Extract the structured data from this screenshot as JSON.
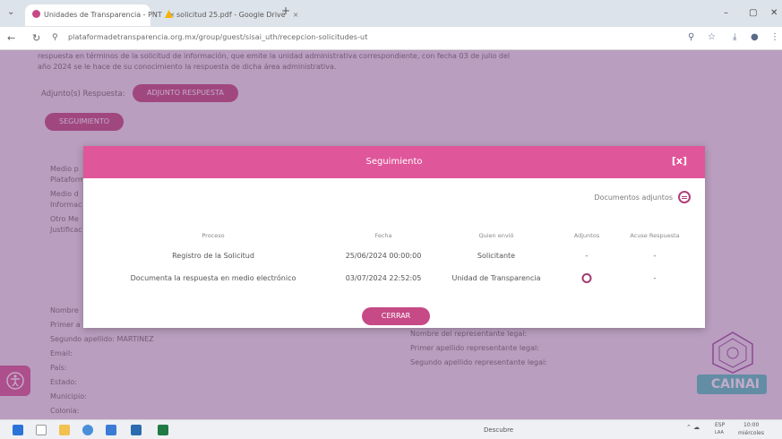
{
  "browser": {
    "tabs": [
      {
        "title": "Unidades de Transparencia - PNT",
        "active": true
      },
      {
        "title": "solicitud 25.pdf - Google Drive",
        "active": false
      }
    ],
    "new_tab": "+",
    "close_glyph": "×",
    "url": "plataformadetransparencia.org.mx/group/guest/sisai_uth/recepcion-solicitudes-ut"
  },
  "page": {
    "text_line_1": "respuesta en términos de la solicitud de información, que emite la unidad administrativa correspondiente, con fecha 03 de julio del",
    "text_line_2": "año 2024 se le hace de su conocimiento la respuesta de dicha área administrativa.",
    "attachment_label": "Adjunto(s) Respuesta:",
    "attachment_button": "ADJUNTO RESPUESTA",
    "tracking_button": "SEGUIMIENTO",
    "left_labels": [
      "Medio p",
      "Plataform",
      "Medio d",
      "Informac",
      "Otro Me",
      "Justificac"
    ],
    "bottom_left": [
      "Nombre",
      "Primer a",
      "Segundo apellido: MARTINEZ",
      "Email:",
      "País:",
      "Estado:",
      "Municipio:",
      "Colonia:"
    ],
    "bottom_right": [
      "Nombre del representante legal:",
      "Primer apellido representante legal:",
      "Segundo apellido representante legal:"
    ],
    "logo_text": "CAINAI"
  },
  "modal": {
    "title": "Seguimiento",
    "close_label": "[x]",
    "documents_label": "Documentos adjuntos",
    "columns": [
      "Proceso",
      "Fecha",
      "Quien envió",
      "Adjuntos",
      "Acuse Respuesta"
    ],
    "rows": [
      {
        "proceso": "Registro de la Solicitud",
        "fecha": "25/06/2024 00:00:00",
        "quien": "Solicitante",
        "adjuntos": "-",
        "acuse": "-"
      },
      {
        "proceso": "Documenta la respuesta en medio electrónico",
        "fecha": "03/07/2024 22:52:05",
        "quien": "Unidad de Transparencia",
        "adjuntos": "icon",
        "acuse": "-"
      }
    ],
    "close_button": "CERRAR"
  },
  "taskbar": {
    "center_text": "Descubre",
    "lang": "ESP",
    "lang_sub": "LAA",
    "time": "10:00",
    "day": "miércoles"
  },
  "colors": {
    "accent": "#e0569a",
    "button": "#c64a86",
    "overlay": "#7a4682",
    "logo": "#52c6c2"
  }
}
